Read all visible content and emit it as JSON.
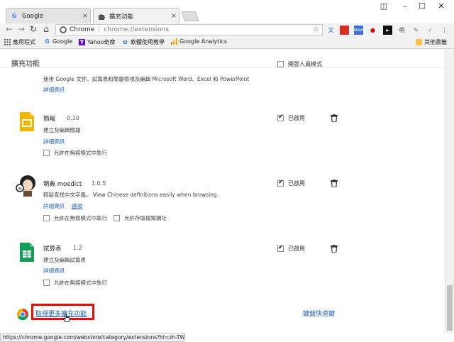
{
  "tabs": [
    {
      "title": "Google",
      "icon": "google-favicon"
    },
    {
      "title": "擴充功能",
      "icon": "puzzle-icon"
    }
  ],
  "toolbar": {
    "origin": "Chrome",
    "path": "chrome://extensions"
  },
  "bookmarks": [
    {
      "label": "應用程式",
      "icon": "apps-grid-icon"
    },
    {
      "label": "Google",
      "icon": "google-favicon"
    },
    {
      "label": "Yahoo奇摩",
      "icon": "yahoo-icon"
    },
    {
      "label": "軟體使用教學",
      "icon": "blog-icon"
    },
    {
      "label": "Google Analytics",
      "icon": "analytics-icon"
    }
  ],
  "other_bookmarks": "其他書籤",
  "page": {
    "title": "擴充功能",
    "dev_mode": "開發人員模式"
  },
  "extensions": [
    {
      "name": "",
      "description": "使用 Google 文件、試算表和簡報檢視及編輯 Microsoft Word、Excel 和 PowerPoint",
      "details": "詳細資訊"
    },
    {
      "name": "簡報",
      "version": "0.10",
      "description": "建立及編輯簡報",
      "details": "詳細資訊",
      "incognito": "允許在無痕模式中執行",
      "enabled": "已啟用"
    },
    {
      "name": "萌典 moedict",
      "version": "1.0.5",
      "description": "輕鬆查找中文字義。 View Chinese definitions easily when browsing.",
      "details": "詳細資訊",
      "options": "選項",
      "incognito": "允許在無痕模式中執行",
      "file_urls": "允許存取檔案網址",
      "enabled": "已啟用"
    },
    {
      "name": "試算表",
      "version": "1.2",
      "description": "建立及編輯試算表",
      "details": "詳細資訊",
      "incognito": "允許在無痕模式中執行",
      "enabled": "已啟用"
    }
  ],
  "footer": {
    "get_more": "取得更多擴充功能",
    "shortcuts": "鍵盤快速鍵"
  },
  "status_url": "https://chrome.google.com/webstore/category/extensions?hl=zh-TW",
  "colors": {
    "link": "#1c5fbf",
    "highlight": "#e01010",
    "slides": "#f4b400",
    "sheets": "#0f9d58"
  }
}
